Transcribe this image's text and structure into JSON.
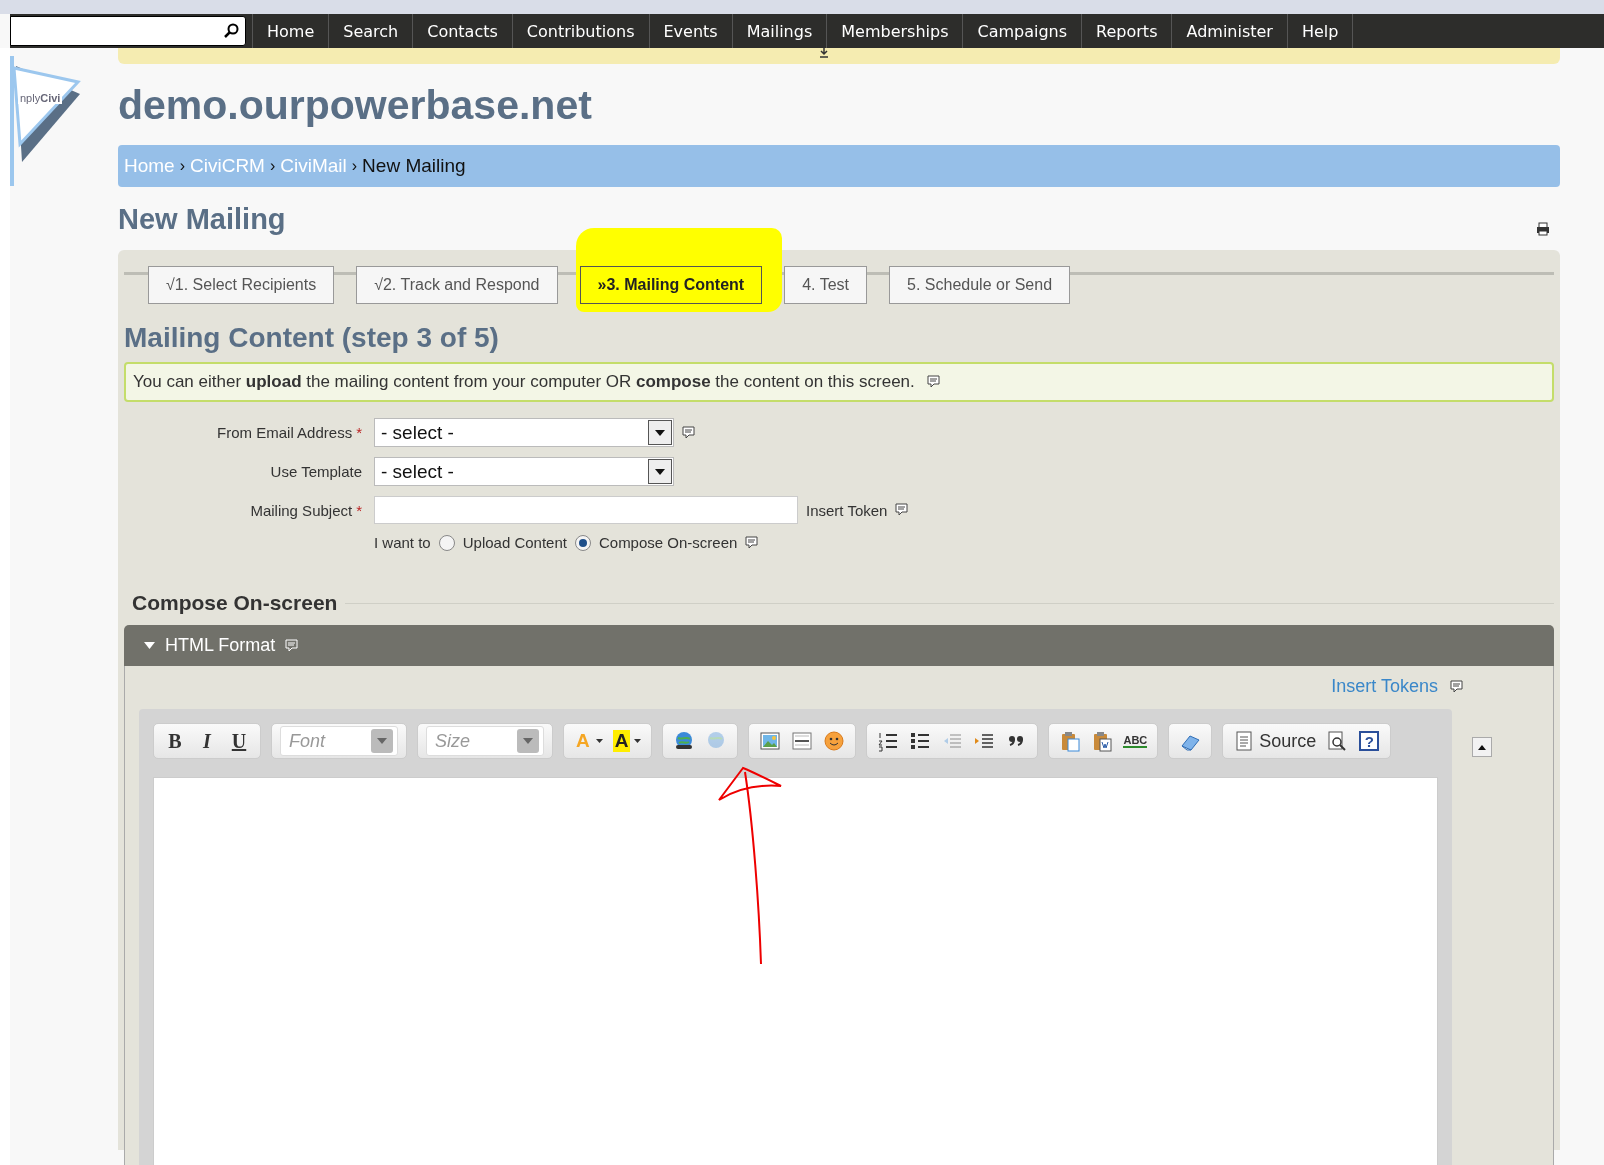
{
  "nav": [
    "Home",
    "Search",
    "Contacts",
    "Contributions",
    "Events",
    "Mailings",
    "Memberships",
    "Campaigns",
    "Reports",
    "Administer",
    "Help"
  ],
  "logo_text": "nply**Civi**",
  "site_title": "demo.ourpowerbase.net",
  "breadcrumb": [
    {
      "kind": "link",
      "text": "Home"
    },
    {
      "kind": "sep",
      "text": "›"
    },
    {
      "kind": "link",
      "text": "CiviCRM"
    },
    {
      "kind": "sep",
      "text": "›"
    },
    {
      "kind": "link",
      "text": "CiviMail"
    },
    {
      "kind": "sep",
      "text": "›"
    },
    {
      "kind": "current",
      "text": "New Mailing"
    }
  ],
  "page_title": "New Mailing",
  "wizard_steps": [
    {
      "label": "√1. Select Recipients",
      "selected": false,
      "highlighted": false
    },
    {
      "label": "√2. Track and Respond",
      "selected": false,
      "highlighted": false
    },
    {
      "label": "»3. Mailing Content",
      "selected": true,
      "highlighted": true
    },
    {
      "label": "4. Test",
      "selected": false,
      "highlighted": false
    },
    {
      "label": "5. Schedule or Send",
      "selected": false,
      "highlighted": false
    }
  ],
  "section_title": "Mailing Content (step 3 of 5)",
  "info": "You can either **upload** the mailing content from your computer OR **compose** the content on this screen.",
  "fields": [
    {
      "kind": "select",
      "label": "From Email Address",
      "required_mark": "*",
      "value": "- select -",
      "help": true
    },
    {
      "kind": "select",
      "label": "Use Template",
      "value": "- select -",
      "help": false
    },
    {
      "kind": "text",
      "label": "Mailing Subject",
      "required_mark": "*",
      "after": "Insert Token",
      "help": true
    }
  ],
  "content_choice": {
    "label": "I want to",
    "options": [
      {
        "label": "Upload Content",
        "selected": false
      },
      {
        "label": "Compose On-screen",
        "selected": true
      }
    ]
  },
  "compose_title": "Compose On-screen",
  "accordion": {
    "title": "HTML Format",
    "expanded": true
  },
  "insert_tokens": "Insert Tokens",
  "toolbar": [
    [
      {
        "kind": "bold",
        "text": "B",
        "disabled": false
      },
      {
        "kind": "italic",
        "text": "I",
        "disabled": false
      },
      {
        "kind": "underline",
        "text": "U",
        "disabled": false
      }
    ],
    [
      {
        "kind": "combo",
        "text": "Font",
        "disabled": false
      }
    ],
    [
      {
        "kind": "combo",
        "text": "Size",
        "disabled": false
      }
    ],
    [
      {
        "kind": "text-color",
        "text": "A",
        "disabled": false
      },
      {
        "kind": "bg-color",
        "text": "A",
        "disabled": false
      }
    ],
    [
      {
        "kind": "link",
        "disabled": false
      },
      {
        "kind": "unlink",
        "disabled": true
      }
    ],
    [
      {
        "kind": "image",
        "disabled": false
      },
      {
        "kind": "rule",
        "disabled": false
      },
      {
        "kind": "smiley",
        "disabled": false
      }
    ],
    [
      {
        "kind": "numbered-list",
        "disabled": false
      },
      {
        "kind": "bulleted-list",
        "disabled": false
      },
      {
        "kind": "outdent",
        "disabled": true
      },
      {
        "kind": "indent",
        "disabled": false
      },
      {
        "kind": "quote",
        "disabled": false
      }
    ],
    [
      {
        "kind": "paste-text",
        "disabled": false
      },
      {
        "kind": "paste-word",
        "disabled": false
      },
      {
        "kind": "spellcheck",
        "text": "ABC",
        "disabled": false
      }
    ],
    [
      {
        "kind": "eraser",
        "disabled": false
      }
    ],
    [
      {
        "kind": "source",
        "text": "Source",
        "disabled": false
      },
      {
        "kind": "preview",
        "disabled": false
      },
      {
        "kind": "help",
        "text": "?",
        "disabled": false
      }
    ]
  ]
}
